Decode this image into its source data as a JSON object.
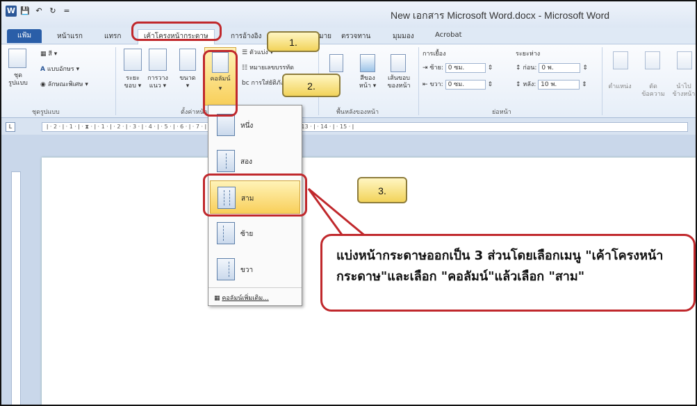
{
  "window": {
    "title": "New เอกสาร Microsoft Word.docx - Microsoft Word",
    "quick_access": [
      "W",
      "💾",
      "↶",
      "↻",
      "="
    ]
  },
  "tabs": [
    "แฟ้ม",
    "หน้าแรก",
    "แทรก",
    "เค้าโครงหน้ากระดาษ",
    "การอ้างอิง",
    "การส่งจดหมาย",
    "ตรวจทาน",
    "มุมมอง",
    "Acrobat"
  ],
  "ribbon": {
    "themes": {
      "colors": "สี",
      "fonts": "แบบอักษร",
      "effects": "ลักษณะพิเศษ",
      "set": "ชุด",
      "set2": "รูปแบบ",
      "group": "ชุดรูปแบบ"
    },
    "page_setup": {
      "margins": "ระยะ",
      "margins2": "ขอบ",
      "orientation": "การวาง",
      "orientation2": "แนว",
      "size": "ขนาด",
      "columns": "คอลัมน์",
      "breaks": "ตัวแบ่ง",
      "line_numbers": "หมายเลขบรรทัด",
      "hyphenation": "การใส่ยัติภังค์",
      "group": "ตั้งค่าหน้ากระดาษ"
    },
    "background": {
      "color": "สีของ",
      "color2": "หน้า",
      "borders": "เส้นขอบ",
      "borders2": "ของหน้า",
      "group": "พื้นหลังของหน้า"
    },
    "paragraph": {
      "indent": "การเยื้อง",
      "left": "ซ้าย:",
      "left_val": "0 ซม.",
      "right": "ขวา:",
      "right_val": "0 ซม.",
      "spacing": "ระยะห่าง",
      "before": "ก่อน:",
      "before_val": "0 พ.",
      "after": "หลัง:",
      "after_val": "10 พ.",
      "group": "ย่อหน้า"
    },
    "arrange": {
      "position": "ตำแหน่ง",
      "wrap": "ตัด",
      "wrap2": "ข้อความ",
      "forward": "นำไป",
      "forward2": "ข้างหน้า"
    }
  },
  "ruler": "ǀ · 2 · ǀ · 1 · ǀ · ⧗ · ǀ · 1 · ǀ · 2 · ǀ · 3 · ǀ · 4 · ǀ · 5 · ǀ · 6 · ǀ · 7 · ǀ · 8 · ǀ · 9 · ǀ · 10 · ǀ · 11 · ǀ · 12 · ǀ · 13 · ǀ · 14 · ǀ · 15 · ǀ",
  "dropdown": {
    "items": [
      "หนึ่ง",
      "สอง",
      "สาม",
      "ซ้าย",
      "ขวา"
    ],
    "more": "คอลัมน์เพิ่มเติม..."
  },
  "callouts": {
    "step1": "1.",
    "step2": "2.",
    "step3": "3.",
    "note": "แบ่งหน้ากระดาษออกเป็น 3 ส่วนโดยเลือกเมนู \"เค้าโครงหน้ากระดาษ\"และเลือก \"คอลัมน์\"แล้วเลือก \"สาม\""
  }
}
